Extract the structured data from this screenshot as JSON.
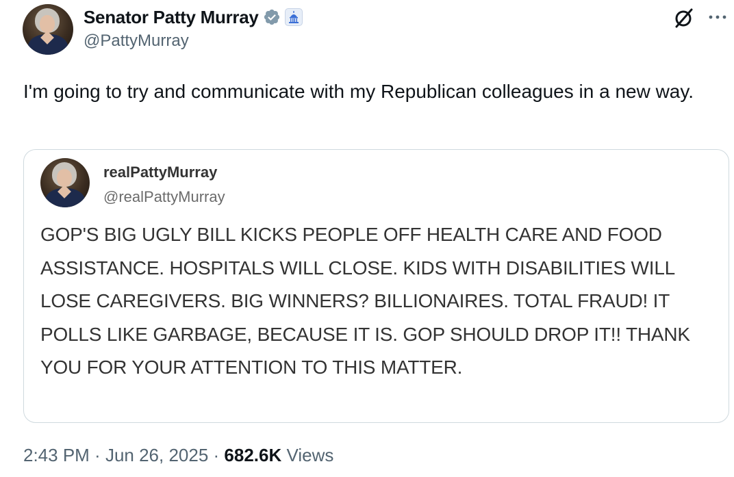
{
  "author": {
    "name": "Senator Patty Murray",
    "handle": "@PattyMurray",
    "verified_color": "#829aab"
  },
  "tweet": {
    "text": "I'm going to try and communicate with my Republican colleagues in a new way."
  },
  "quoted": {
    "name": "realPattyMurray",
    "handle": "@realPattyMurray",
    "text": "GOP'S BIG UGLY BILL KICKS PEOPLE OFF HEALTH CARE AND FOOD ASSISTANCE. HOSPITALS WILL CLOSE. KIDS WITH DISABILITIES WILL LOSE CAREGIVERS. BIG WINNERS? BILLIONAIRES. TOTAL FRAUD! IT POLLS LIKE GARBAGE, BECAUSE IT IS. GOP SHOULD DROP IT!! THANK YOU FOR YOUR ATTENTION TO THIS MATTER."
  },
  "footer": {
    "time": "2:43 PM",
    "separator": " · ",
    "date": "Jun 26, 2025",
    "views_count": "682.6K",
    "views_label": "Views"
  },
  "icons": {
    "grok": "grok-icon",
    "more": "more-icon"
  }
}
